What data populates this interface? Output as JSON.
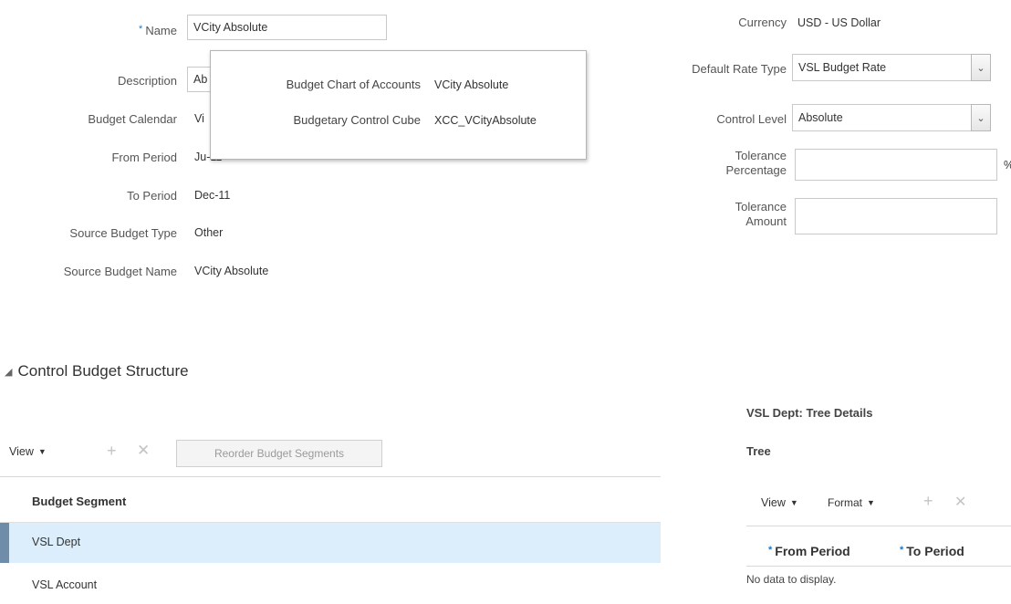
{
  "form": {
    "name_label": "Name",
    "name_value": "VCity Absolute",
    "description_label": "Description",
    "description_partial": "Ab",
    "calendar_label": "Budget Calendar",
    "calendar_partial": "Vi",
    "from_period_label": "From Period",
    "from_period_partial": "Ju-11",
    "to_period_label": "To Period",
    "to_period_value": "Dec-11",
    "source_type_label": "Source Budget Type",
    "source_type_value": "Other",
    "source_name_label": "Source Budget Name",
    "source_name_value": "VCity Absolute"
  },
  "popup": {
    "coa_label": "Budget Chart of Accounts",
    "coa_value": "VCity Absolute",
    "cube_label": "Budgetary Control Cube",
    "cube_value": "XCC_VCityAbsolute"
  },
  "right_form": {
    "currency_label": "Currency",
    "currency_value": "USD - US Dollar",
    "rate_type_label": "Default Rate Type",
    "rate_type_value": "VSL Budget Rate",
    "control_level_label": "Control Level",
    "control_level_value": "Absolute",
    "tol_pct_label_1": "Tolerance",
    "tol_pct_label_2": "Percentage",
    "tol_pct_value": "",
    "tol_pct_suffix": "%",
    "tol_amt_label_1": "Tolerance",
    "tol_amt_label_2": "Amount",
    "tol_amt_value": ""
  },
  "structure": {
    "title": "Control Budget Structure",
    "toolbar": {
      "view_label": "View",
      "reorder_label": "Reorder Budget Segments"
    },
    "column_header": "Budget Segment",
    "rows": [
      "VSL Dept",
      "VSL Account"
    ]
  },
  "tree_details": {
    "title": "VSL Dept: Tree Details",
    "tree_label": "Tree",
    "view_label": "View",
    "format_label": "Format",
    "col_from": "From Period",
    "col_to": "To Period",
    "empty_text": "No data to display."
  },
  "colors": {
    "selected_row": "#dceefb",
    "selected_marker": "#6f8ca8",
    "required_star": "#1a7ac8"
  },
  "icons": [
    "triangle-expand-icon",
    "dropdown-arrow-icon",
    "chevron-down-icon",
    "plus-icon",
    "close-x-icon"
  ]
}
